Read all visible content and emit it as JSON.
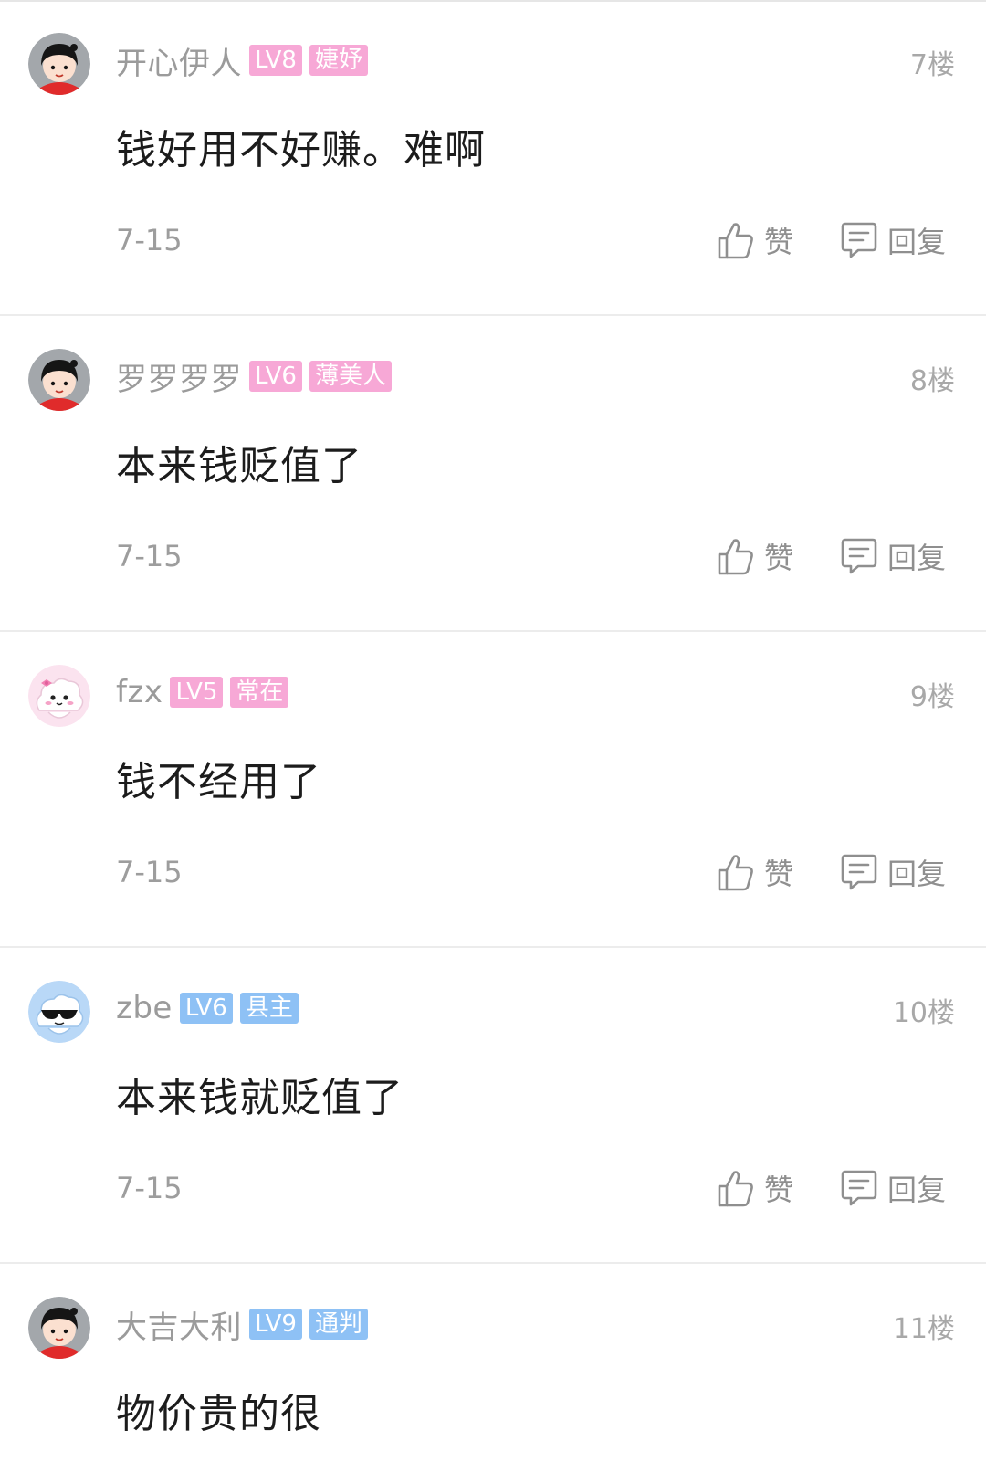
{
  "colors": {
    "badge_pink": "#f7a8d6",
    "badge_blue": "#8ec1f5",
    "meta_text": "#9b9b9b",
    "content_text": "#1c1c1c"
  },
  "actions": {
    "like_label": "赞",
    "reply_label": "回复",
    "like_icon": "thumbs-up-icon",
    "reply_icon": "comment-bubble-icon"
  },
  "comments": [
    {
      "avatar": "girl-avatar",
      "username": "开心伊人",
      "level": "LV8",
      "title": "婕妤",
      "badge_color": "pink",
      "floor": "7楼",
      "content": "钱好用不好赚。难啊",
      "date": "7-15"
    },
    {
      "avatar": "girl-avatar",
      "username": "罗罗罗罗",
      "level": "LV6",
      "title": "薄美人",
      "badge_color": "pink",
      "floor": "8楼",
      "content": "本来钱贬值了",
      "date": "7-15"
    },
    {
      "avatar": "pink-cloud-avatar",
      "username": "fzx",
      "level": "LV5",
      "title": "常在",
      "badge_color": "pink",
      "floor": "9楼",
      "content": "钱不经用了",
      "date": "7-15"
    },
    {
      "avatar": "sunglasses-cloud-avatar",
      "username": "zbe",
      "level": "LV6",
      "title": "县主",
      "badge_color": "blue",
      "floor": "10楼",
      "content": "本来钱就贬值了",
      "date": "7-15"
    },
    {
      "avatar": "girl-avatar",
      "username": "大吉大利",
      "level": "LV9",
      "title": "通判",
      "badge_color": "blue",
      "floor": "11楼",
      "content": "物价贵的很",
      "date": ""
    }
  ]
}
